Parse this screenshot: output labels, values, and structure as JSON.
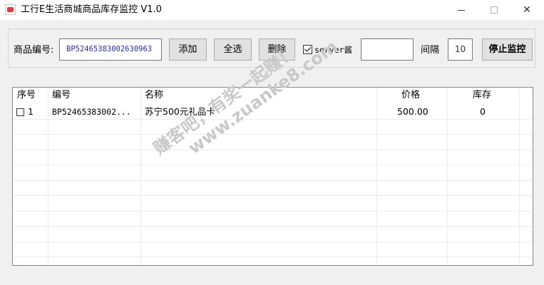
{
  "window": {
    "title": "工行E生活商城商品库存监控 V1.0",
    "icons": {
      "app": "app-icon",
      "minimize": "minimize-icon",
      "maximize": "maximize-icon",
      "close": "close-icon"
    },
    "close_glyph": "✕"
  },
  "toolbar": {
    "code_label": "商品编号:",
    "code_value": "BP52465383002630963",
    "add_label": "添加",
    "select_all_label": "全选",
    "delete_label": "删除",
    "server_label": "server酱",
    "server_checked": true,
    "server_key_value": "",
    "interval_label": "间隔",
    "interval_value": "10",
    "stop_label": "停止监控"
  },
  "table": {
    "columns": [
      "序号",
      "编号",
      "名称",
      "价格",
      "库存"
    ],
    "rows": [
      {
        "checked": false,
        "index": "1",
        "code": "BP52465383002...",
        "name": "苏宁500元礼品卡",
        "price": "500.00",
        "stock": "0"
      }
    ]
  },
  "watermark": {
    "line1": "赚客吧，有奖一起赚！",
    "line2": "www.zuanke8.com"
  },
  "colors": {
    "input_text": "#2b2bbf",
    "title_icon": "#e23b3b"
  }
}
